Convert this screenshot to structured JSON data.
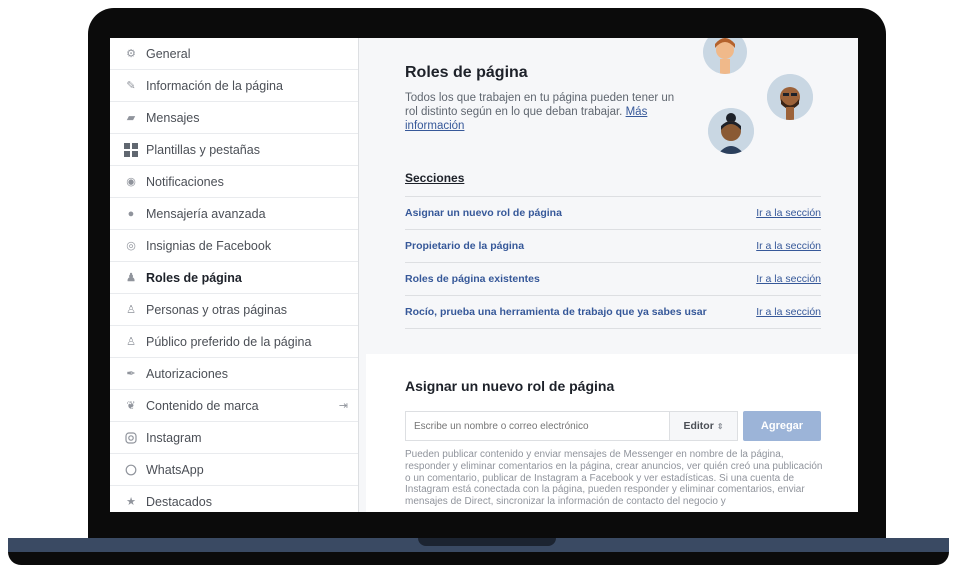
{
  "sidebar": {
    "items": [
      {
        "label": "General",
        "icon": "gear-icon"
      },
      {
        "label": "Información de la página",
        "icon": "pencil-icon"
      },
      {
        "label": "Mensajes",
        "icon": "messages-icon"
      },
      {
        "label": "Plantillas y pestañas",
        "icon": "grid-icon"
      },
      {
        "label": "Notificaciones",
        "icon": "globe-icon"
      },
      {
        "label": "Mensajería avanzada",
        "icon": "chat-bubble-icon"
      },
      {
        "label": "Insignias de Facebook",
        "icon": "badge-icon"
      },
      {
        "label": "Roles de página",
        "icon": "person-icon",
        "active": true
      },
      {
        "label": "Personas y otras páginas",
        "icon": "people-icon"
      },
      {
        "label": "Público preferido de la página",
        "icon": "people-icon"
      },
      {
        "label": "Autorizaciones",
        "icon": "wrench-icon"
      },
      {
        "label": "Contenido de marca",
        "icon": "handshake-icon",
        "trailing_icon": "external-link-icon"
      },
      {
        "label": "Instagram",
        "icon": "instagram-icon"
      },
      {
        "label": "WhatsApp",
        "icon": "whatsapp-icon"
      },
      {
        "label": "Destacados",
        "icon": "star-icon"
      }
    ]
  },
  "roles": {
    "title": "Roles de página",
    "description": "Todos los que trabajen en tu página pueden tener un rol distinto según en lo que deban trabajar.",
    "more_link": "Más información",
    "sections_title": "Secciones",
    "sections": [
      {
        "label": "Asignar un nuevo rol de página",
        "link": "Ir a la sección"
      },
      {
        "label": "Propietario de la página",
        "link": "Ir a la sección"
      },
      {
        "label": "Roles de página existentes",
        "link": "Ir a la sección"
      },
      {
        "label": "Rocío, prueba una herramienta de trabajo que ya sabes usar",
        "link": "Ir a la sección"
      }
    ]
  },
  "assign": {
    "title": "Asignar un nuevo rol de página",
    "input_placeholder": "Escribe un nombre o correo electrónico",
    "role_value": "Editor",
    "add_button": "Agregar",
    "explanation": "Pueden publicar contenido y enviar mensajes de Messenger en nombre de la página, responder y eliminar comentarios en la página, crear anuncios, ver quién creó una publicación o un comentario, publicar de Instagram a Facebook y ver estadísticas. Si una cuenta de Instagram está conectada con la página, pueden responder y eliminar comentarios, enviar mensajes de Direct, sincronizar la información de contacto del negocio y"
  },
  "colors": {
    "link_blue": "#365899",
    "button_disabled": "#9cb4d8",
    "device_frame": "#0b0b0b",
    "device_base": "#3a4a63"
  }
}
